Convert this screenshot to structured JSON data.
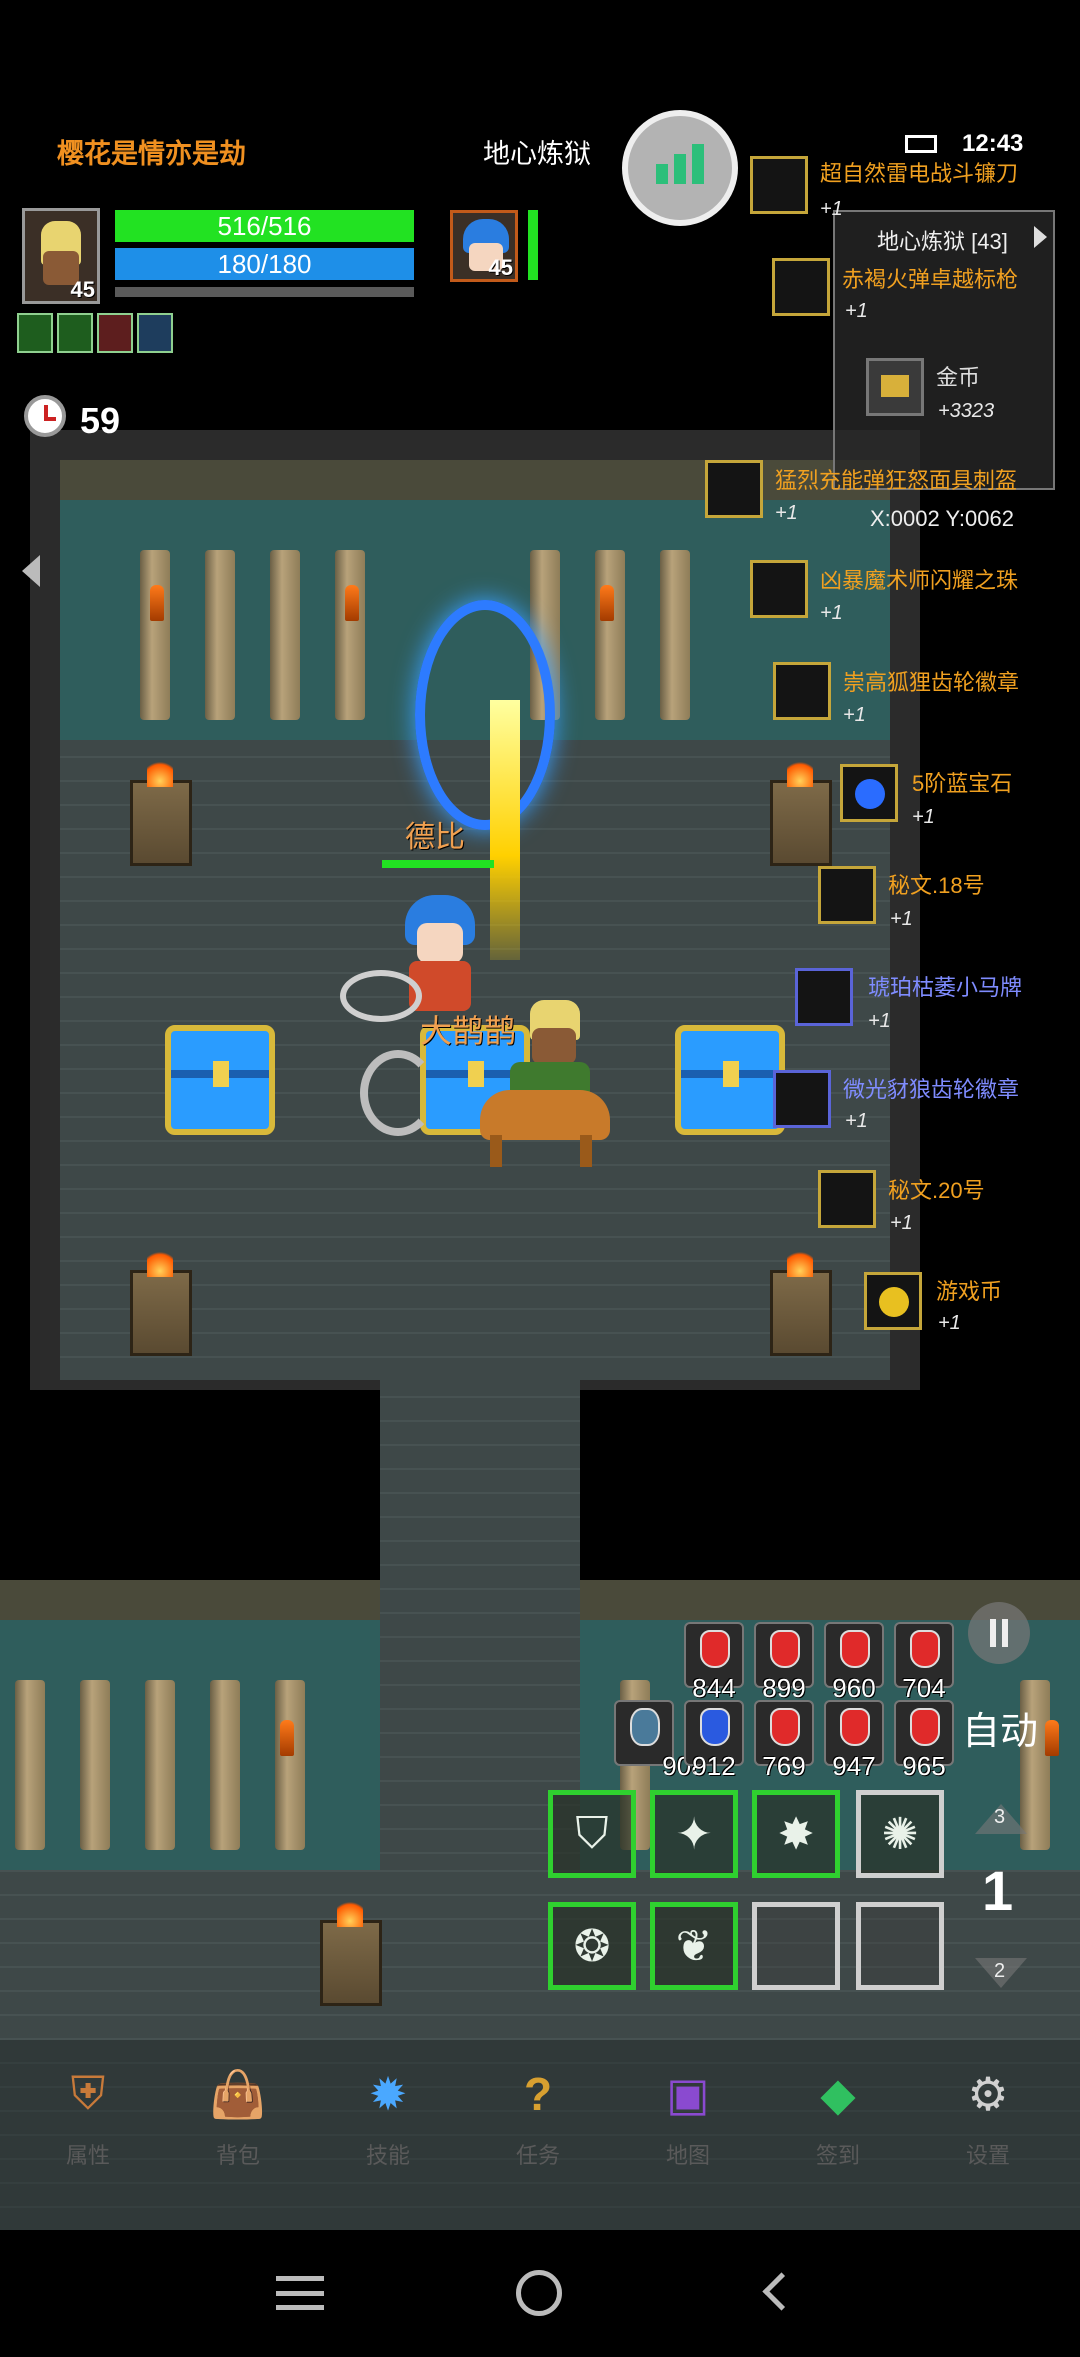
{
  "player": {
    "name": "樱花是情亦是劫",
    "level": "45",
    "hp": "516/516",
    "mp": "180/180"
  },
  "zone": {
    "name": "地心炼狱",
    "minimap_title": "地心炼狱 [43]",
    "coords": "X:0002  Y:0062"
  },
  "status_bar": {
    "time": "12:43"
  },
  "pet": {
    "level": "45"
  },
  "timer": {
    "value": "59"
  },
  "characters": {
    "npc_name": "德比",
    "mount_name": "大鹊鹊"
  },
  "loot": [
    {
      "name": "超自然雷电战斗镰刀",
      "qty": "+1",
      "color": "#f0a020",
      "icon": "scythe-icon"
    },
    {
      "name": "赤褐火弹卓越标枪",
      "qty": "+1",
      "color": "#f0a020",
      "icon": "spear-icon"
    },
    {
      "name": "金币",
      "qty": "+3323",
      "color": "#dddddd",
      "icon": "gold-coin-icon"
    },
    {
      "name": "猛烈充能弹狂怒面具刺盔",
      "qty": "+1",
      "color": "#f0a020",
      "icon": "helmet-icon"
    },
    {
      "name": "凶暴魔术师闪耀之珠",
      "qty": "+1",
      "color": "#f0a020",
      "icon": "orb-staff-icon"
    },
    {
      "name": "崇高狐狸齿轮徽章",
      "qty": "+1",
      "color": "#f0a020",
      "icon": "gear-badge-icon"
    },
    {
      "name": "5阶蓝宝石",
      "qty": "+1",
      "color": "#f0a020",
      "icon": "sapphire-icon"
    },
    {
      "name": "秘文.18号",
      "qty": "+1",
      "color": "#f0a020",
      "icon": "rune-stone-icon"
    },
    {
      "name": "琥珀枯萎小马牌",
      "qty": "+1",
      "color": "#7f8cff",
      "icon": "amber-tag-icon"
    },
    {
      "name": "微光豺狼齿轮徽章",
      "qty": "+1",
      "color": "#7f8cff",
      "icon": "gear-badge-icon"
    },
    {
      "name": "秘文.20号",
      "qty": "+1",
      "color": "#f0a020",
      "icon": "rune-stone-icon"
    },
    {
      "name": "游戏币",
      "qty": "+1",
      "color": "#f0a020",
      "icon": "game-coin-icon"
    }
  ],
  "potions": {
    "row1": [
      "844",
      "899",
      "960",
      "704"
    ],
    "row2": [
      "908",
      "912",
      "769",
      "947",
      "965"
    ]
  },
  "controls": {
    "auto_label": "自动",
    "page_up": "3",
    "page_current": "1",
    "page_down": "2"
  },
  "bottom_nav": [
    {
      "label": "属性",
      "icon": "armor-icon"
    },
    {
      "label": "背包",
      "icon": "bag-icon"
    },
    {
      "label": "技能",
      "icon": "skill-gem-icon"
    },
    {
      "label": "任务",
      "icon": "quest-icon"
    },
    {
      "label": "地图",
      "icon": "map-icon"
    },
    {
      "label": "签到",
      "icon": "gem-icon"
    },
    {
      "label": "设置",
      "icon": "gear-icon"
    }
  ],
  "colors": {
    "hp": "#22e222",
    "mp": "#1e8fe8",
    "player_name": "#f09020"
  }
}
